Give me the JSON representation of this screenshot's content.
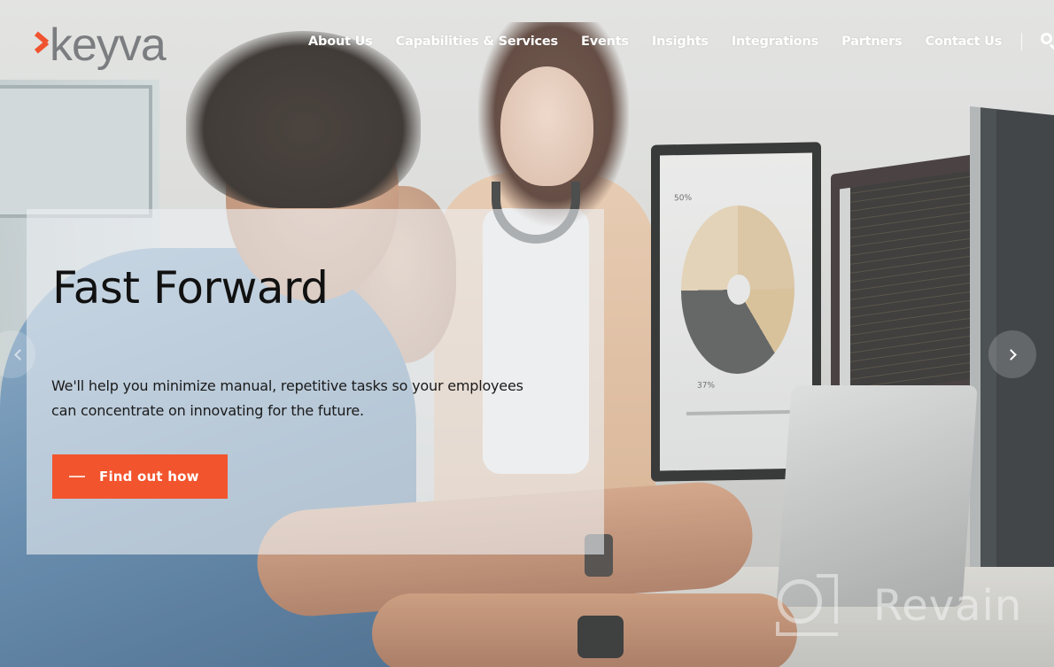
{
  "brand": {
    "name": "keyva",
    "accent_color": "#f2542d",
    "logo_text_color": "#7b7d80"
  },
  "nav": {
    "items": [
      {
        "label": "About Us"
      },
      {
        "label": "Capabilities & Services"
      },
      {
        "label": "Events"
      },
      {
        "label": "Insights"
      },
      {
        "label": "Integrations"
      },
      {
        "label": "Partners"
      },
      {
        "label": "Contact Us"
      }
    ],
    "search_icon": "search-icon"
  },
  "hero": {
    "title": "Fast Forward",
    "description": "We'll help you minimize manual, repetitive tasks so your employees can concentrate on innovating for the future.",
    "cta_label": "Find out how",
    "background": "photo of coworkers at computer monitors",
    "background_screen_labels": {
      "top_label": "50%",
      "bottom_label": "37%"
    }
  },
  "carousel": {
    "prev_icon": "chevron-left-icon",
    "next_icon": "chevron-right-icon"
  },
  "watermark": {
    "text": "Revain"
  }
}
